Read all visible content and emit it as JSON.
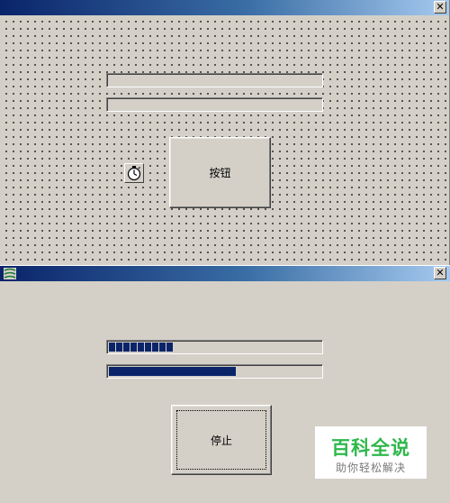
{
  "designer_window": {
    "button_label": "按钮",
    "close_label": "✕",
    "timer_icon": "stopwatch-icon"
  },
  "runtime_window": {
    "close_label": "✕",
    "app_icon": "app-logo-icon",
    "stop_button_label": "停止",
    "segmented_progress": {
      "value_percent": 30,
      "segments_filled": 9
    },
    "smooth_progress": {
      "value_percent": 60
    }
  },
  "watermark": {
    "title": "百科全说",
    "subtitle": "助你轻松解决",
    "color": "#2eb84b"
  },
  "colors": {
    "face": "#d4d0c8",
    "title_start": "#0a246a",
    "title_end": "#a6caf0",
    "progress": "#0a246a"
  }
}
